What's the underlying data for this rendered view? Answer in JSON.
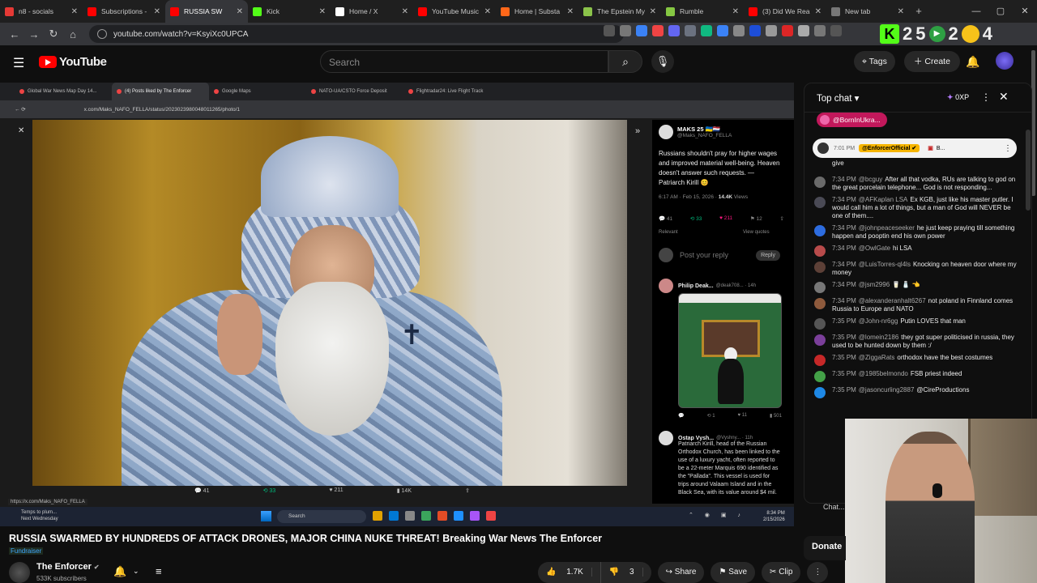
{
  "browser": {
    "tabs": [
      {
        "label": "n8 - socials",
        "color": "#e53935"
      },
      {
        "label": "Subscriptions -",
        "color": "#ff0000"
      },
      {
        "label": "RUSSIA SW",
        "color": "#ff0000"
      },
      {
        "label": "Kick",
        "color": "#53fc18"
      },
      {
        "label": "Home / X",
        "color": "#ffffff"
      },
      {
        "label": "YouTube Music",
        "color": "#ff0000"
      },
      {
        "label": "Home | Substa",
        "color": "#ff6719"
      },
      {
        "label": "The Epstein My",
        "color": "#8bc34a"
      },
      {
        "label": "Rumble",
        "color": "#85c742"
      },
      {
        "label": "(3) Did We Rea",
        "color": "#ff0000"
      },
      {
        "label": "New tab",
        "color": "#777777"
      }
    ],
    "url": "youtube.com/watch?v=KsyiXc0UPCA",
    "toolbar_numbers": [
      "2",
      "5",
      "2",
      "4"
    ],
    "kick_letter": "K"
  },
  "youtube": {
    "logo": "YouTube",
    "search_placeholder": "Search",
    "tags_label": "Tags",
    "create_label": "Create"
  },
  "inner_browser": {
    "tabs": [
      "Global War News Map Day 14...",
      "(4) Posts liked by The Enforcer",
      "Google Maps",
      "NATO-UA/CSTO Force Deposit",
      "Flightradar24: Live Flight Track"
    ],
    "url": "x.com/Maks_NAFO_FELLA/status/2023023980048011265/photo/1",
    "status_url": "https://x.com/Maks_NAFO_FELLA"
  },
  "tweet": {
    "name": "MAKS 25 🇺🇦🇳🇱",
    "handle": "@Maks_NAFO_FELLA",
    "text": "Russians shouldn't pray for higher wages and improved material well-being. Heaven doesn't answer such requests. — Patriarch Kirill 😊",
    "time": "6:17 AM · Feb 15, 2026 · ",
    "views": "14.4K",
    "views_label": " Views",
    "stats": {
      "replies": "41",
      "reposts": "33",
      "likes": "211",
      "bookmarks": "12"
    },
    "relevant": "Relevant",
    "view_quotes": "View quotes",
    "reply_placeholder": "Post your reply",
    "reply_button": "Reply"
  },
  "reply1": {
    "name": "Philip Deak...",
    "handle": "@deak708... · 14h",
    "stats": {
      "replies": "",
      "reposts": "1",
      "likes": "11",
      "views": "501"
    }
  },
  "reply2": {
    "name": "Ostap Vysh...",
    "handle": "@Vyshny... · 11h",
    "text": "Patriarch Kirill, head of the Russian Orthodox Church, has been linked to the use of a luxury yacht, often reported to be a 22-meter Marquis 690 identified as the \"Palladа\". This vessel is used for trips around Valaam Island and in the Black Sea, with its value around $4 mil."
  },
  "photo_bar": {
    "replies": "41",
    "reposts": "33",
    "likes": "211",
    "views": "14K"
  },
  "taskbar": {
    "weather_line1": "Temps to plum...",
    "weather_line2": "Next Wednesday",
    "search": "Search",
    "time": "8:34 PM",
    "date": "2/15/2026"
  },
  "video": {
    "title": "RUSSIA SWARMED BY HUNDREDS OF ATTACK DRONES, MAJOR CHINA NUKE THREAT! Breaking War News The Enforcer",
    "badge": "Fundraiser",
    "channel": "The Enforcer",
    "subscribers": "533K subscribers",
    "likes": "1.7K",
    "dislikes": "3",
    "share": "Share",
    "save": "Save",
    "clip": "Clip"
  },
  "chat": {
    "title": "Top chat ▾",
    "xp": "0XP",
    "pinned_user": "@BornInUkra...",
    "ticker_time": "7:01 PM",
    "ticker_user": "@EnforcerOfficial ✔",
    "ticker_badge": "B...",
    "first_line": "give",
    "messages": [
      {
        "time": "7:34 PM",
        "user": "@bcguy",
        "text": "After all that vodka, RUs are talking to god on the great porcelain telephone... God is not responding...",
        "color": "#6a6a6a"
      },
      {
        "time": "7:34 PM",
        "user": "@AFKaplan LSA",
        "text": "Ex KGB, just like his master putler. I would call him a lot of things, but a man of God will NEVER be one of them....",
        "color": "#4a4a55"
      },
      {
        "time": "7:34 PM",
        "user": "@johnpeaceseeker",
        "text": "he just keep praying till something happen and pooptin end his own power",
        "color": "#2d6cdf"
      },
      {
        "time": "7:34 PM",
        "user": "@OwlGate",
        "text": "hi LSA",
        "color": "#b84b4b"
      },
      {
        "time": "7:34 PM",
        "user": "@LuisTorres-ql4ls",
        "text": "Knocking on heaven door where my money",
        "color": "#5d4037"
      },
      {
        "time": "7:34 PM",
        "user": "@jsm2996",
        "text": "🥛 🧂 👈",
        "color": "#777777"
      },
      {
        "time": "7:34 PM",
        "user": "@alexanderanhalt6267",
        "text": "not poland in Finnland comes Russia to Europe and NATO",
        "color": "#8e5a3c"
      },
      {
        "time": "7:35 PM",
        "user": "@John-nr6gg",
        "text": "Putin LOVES that man",
        "color": "#555555"
      },
      {
        "time": "7:35 PM",
        "user": "@lomein2186",
        "text": "they got super politicised in russia, they used to be hunted down by them :/",
        "color": "#7b3f9a"
      },
      {
        "time": "7:35 PM",
        "user": "@ZiggaRats",
        "text": "orthodox have the best costumes",
        "color": "#c62828"
      },
      {
        "time": "7:35 PM",
        "user": "@1985belmondo",
        "text": "FSB priest indeed",
        "color": "#43a047"
      },
      {
        "time": "7:35 PM",
        "user": "@jasoncurling2887",
        "text": "@CireProductions",
        "color": "#1e88e5"
      }
    ],
    "input_hint": "Chat...",
    "donate": "Donate"
  }
}
